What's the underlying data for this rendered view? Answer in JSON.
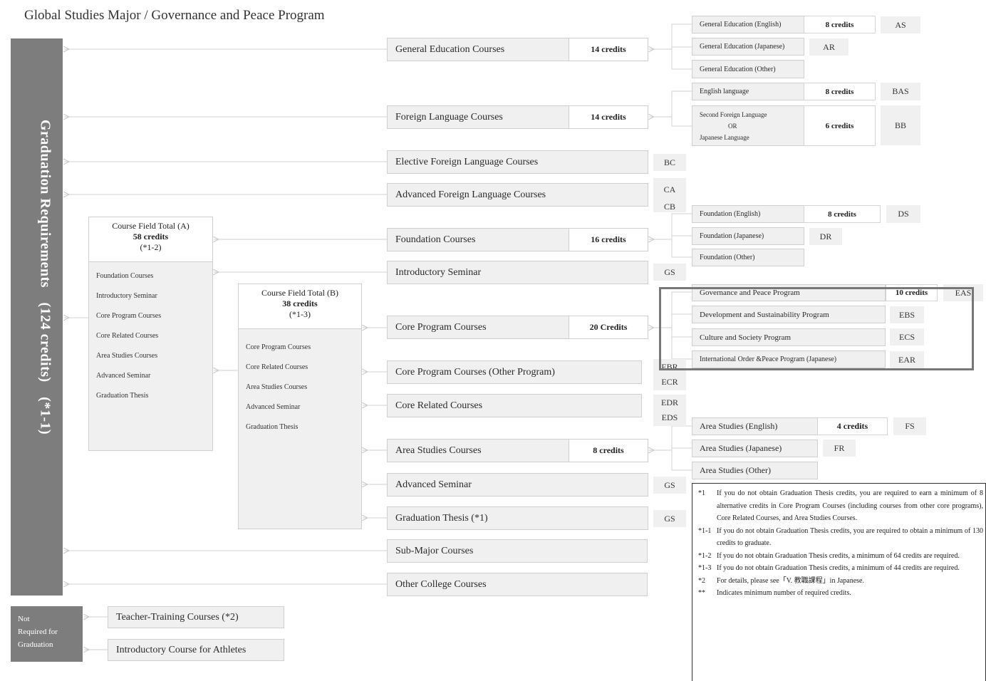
{
  "title": "Global Studies Major / Governance and Peace Program",
  "graduation_label": "Graduation Requirements　(124 credits)　(*1-1)",
  "not_required": [
    "Not",
    "Required for",
    "Graduation"
  ],
  "main_courses": {
    "general_education": "General Education Courses",
    "foreign_language": "Foreign Language Courses",
    "elective_foreign_language": "Elective Foreign Language Courses",
    "advanced_foreign_language": "Advanced Foreign Language Courses",
    "foundation": "Foundation Courses",
    "introductory_seminar": "Introductory Seminar",
    "core_program": "Core Program Courses",
    "core_program_other": "Core Program Courses (Other Program)",
    "core_related": "Core Related Courses",
    "area_studies": "Area Studies Courses",
    "advanced_seminar": "Advanced Seminar",
    "graduation_thesis": "Graduation Thesis (*1)",
    "sub_major": "Sub-Major Courses",
    "other_college": "Other College Courses",
    "teacher_training": "Teacher-Training Courses (*2)",
    "intro_athletes": "Introductory Course for Athletes"
  },
  "main_credits": {
    "general_education": "14 credits",
    "foreign_language": "14 credits",
    "foundation": "16 credits",
    "core_program": "20 Credits",
    "area_studies": "8 credits"
  },
  "codes": {
    "elective_fl": "BC",
    "adv_fl_1": "CA",
    "adv_fl_2": "CB",
    "intro_seminar": "GS",
    "core_other_1": "EBR",
    "core_other_2": "ECR",
    "core_related_1": "EDR",
    "core_related_2": "EDS",
    "adv_seminar": "GS",
    "thesis": "GS"
  },
  "sub_courses": {
    "ge_english": "General Education (English)",
    "ge_english_credits": "8 credits",
    "ge_english_code": "AS",
    "ge_japanese": "General Education (Japanese)",
    "ge_japanese_code": "AR",
    "ge_other": "General Education (Other)",
    "english_language": "English language",
    "english_language_credits": "8 credits",
    "english_language_code": "BAS",
    "second_fl_line1": "Second Foreign Language",
    "second_fl_line2": "OR",
    "second_fl_line3": "Japanese Language",
    "second_fl_credits": "6 credits",
    "second_fl_code": "BB",
    "foundation_english": "Foundation (English)",
    "foundation_english_credits": "8 credits",
    "foundation_english_code": "DS",
    "foundation_japanese": "Foundation (Japanese)",
    "foundation_japanese_code": "DR",
    "foundation_other": "Foundation (Other)",
    "gpp": "Governance and Peace Program",
    "gpp_credits": "10 credits",
    "gpp_code": "EAS",
    "dsp": "Development and Sustainability Program",
    "dsp_code": "EBS",
    "csp": "Culture and Society Program",
    "csp_code": "ECS",
    "iop": "International Order &Peace Program (Japanese)",
    "iop_code": "EAR",
    "area_english": "Area Studies (English)",
    "area_english_credits": "4 credits",
    "area_english_code": "FS",
    "area_japanese": "Area Studies (Japanese)",
    "area_japanese_code": "FR",
    "area_other": "Area Studies (Other)"
  },
  "field_total_a": {
    "title": "Course Field Total (A)",
    "credits": "58 credits",
    "note": "(*1-2)",
    "items": [
      "Foundation Courses",
      "Introductory Seminar",
      "Core Program Courses",
      "Core Related Courses",
      "Area Studies Courses",
      "Advanced Seminar",
      "Graduation Thesis"
    ]
  },
  "field_total_b": {
    "title": "Course Field Total (B)",
    "credits": "38 credits",
    "note": "(*1-3)",
    "items": [
      "Core Program Courses",
      "Core Related Courses",
      "Area Studies Courses",
      "Advanced Seminar",
      "Graduation Thesis"
    ]
  },
  "notes": [
    {
      "key": "*1",
      "text": "If you do not obtain Graduation Thesis credits, you are required to earn a minimum of 8 alternative credits in Core Program Courses (including courses from other core programs), Core Related Courses, and Area Studies Courses."
    },
    {
      "key": "*1-1",
      "text": "If you do not obtain Graduation Thesis credits, you are required to obtain a minimum of 130 credits to graduate."
    },
    {
      "key": "*1-2",
      "text": "If you do not obtain Graduation Thesis credits, a minimum of 64 credits are required."
    },
    {
      "key": "*1-3",
      "text": "If you do not obtain Graduation Thesis credits, a minimum of 44 credits are required."
    },
    {
      "key": "*2",
      "text": "For details, please see「V. 教職課程」in Japanese."
    },
    {
      "key": "**",
      "text": "Indicates minimum number of required credits."
    }
  ]
}
